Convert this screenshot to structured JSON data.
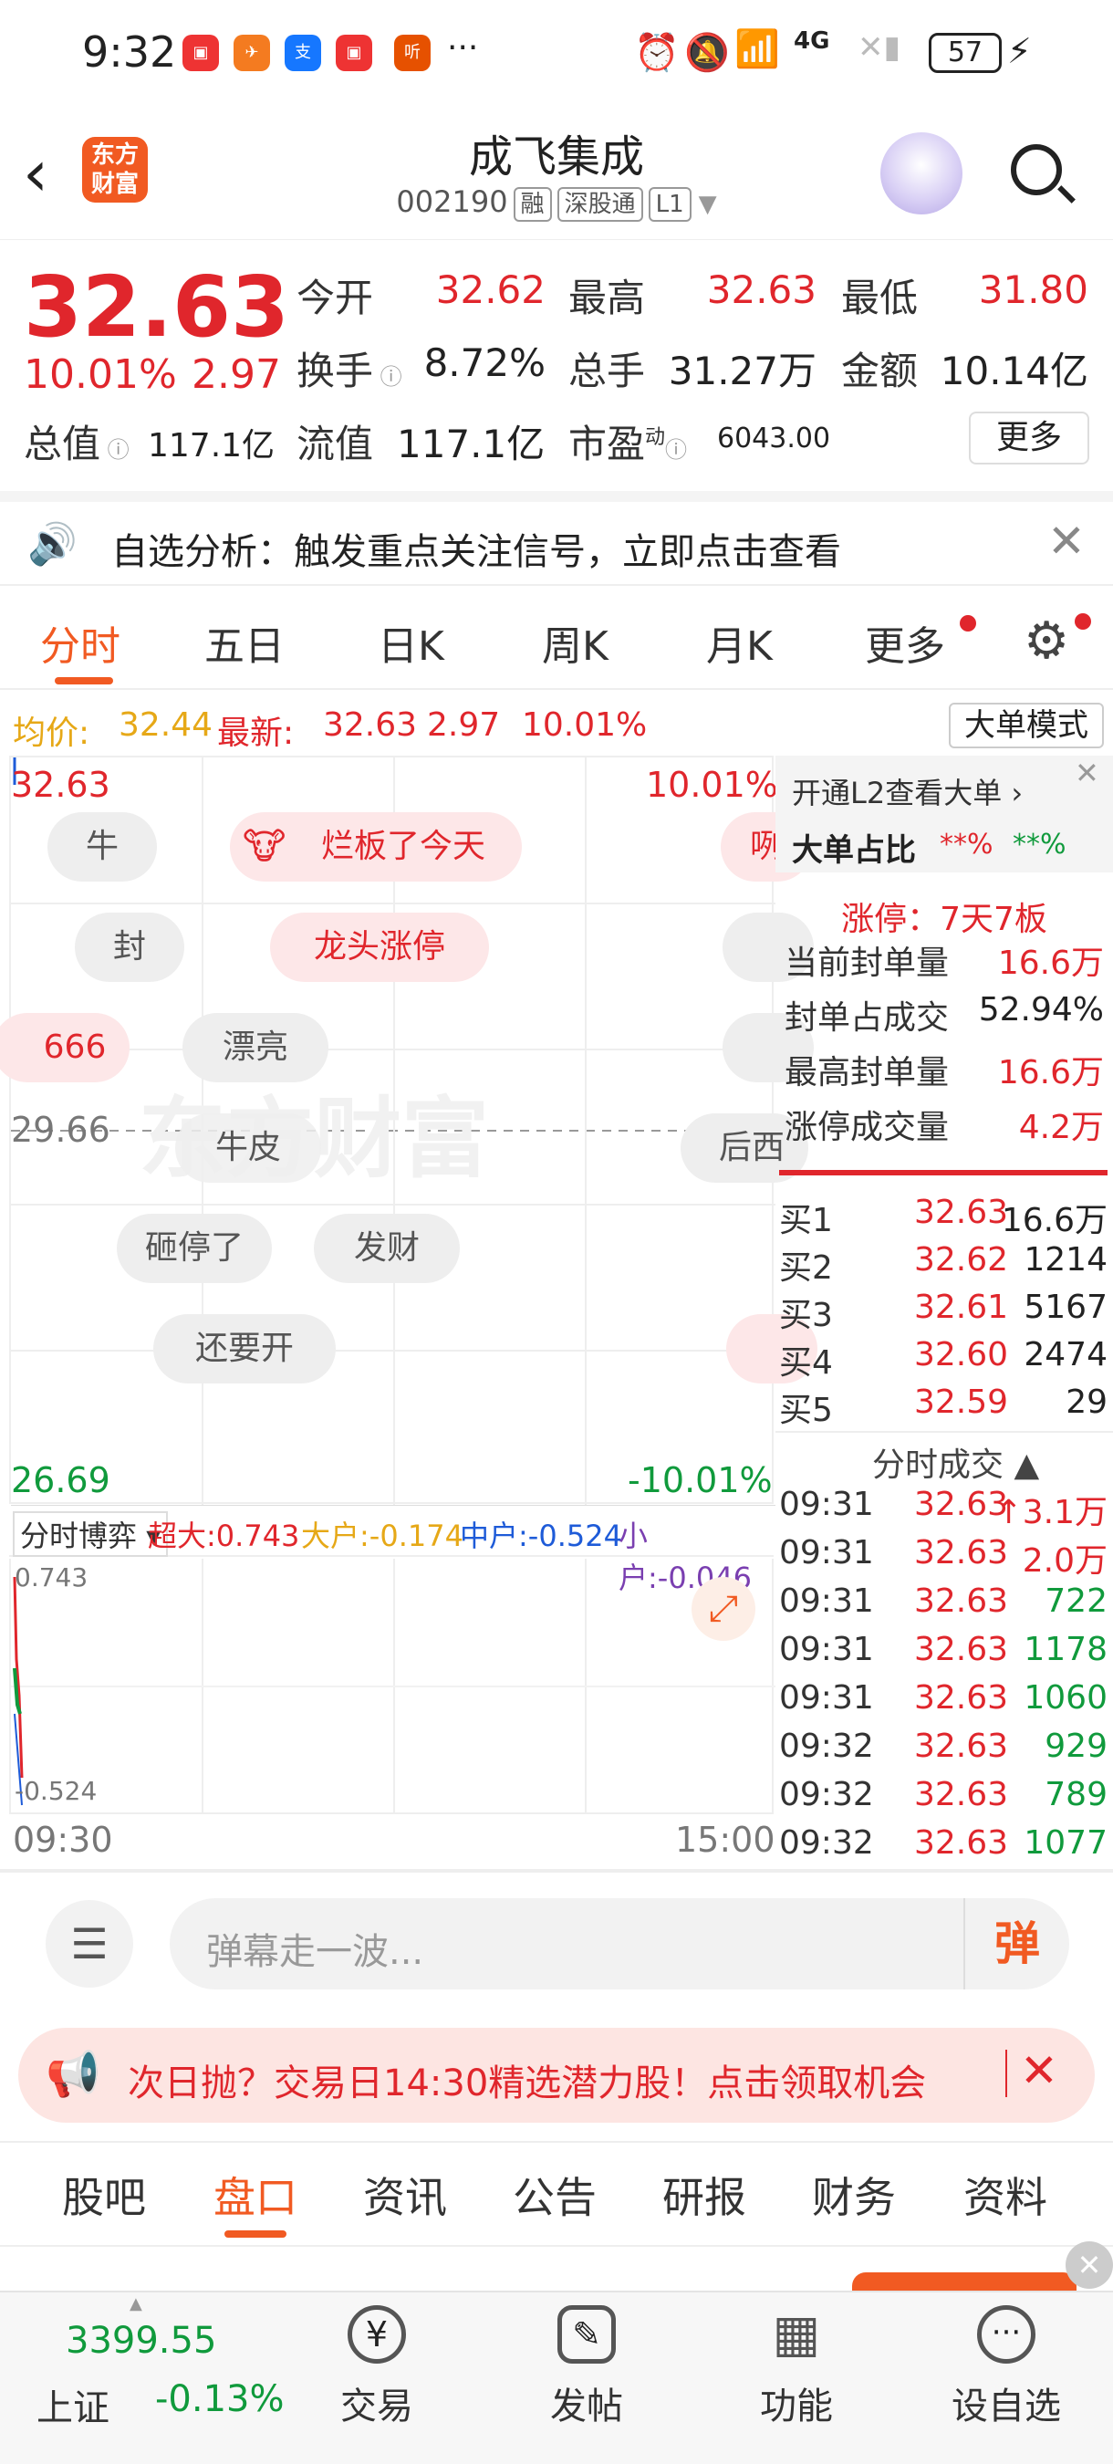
{
  "status_bar": {
    "time": "9:32",
    "dots": "···",
    "network": "4G",
    "battery": "57"
  },
  "header": {
    "logo_line1": "东方",
    "logo_line2": "财富",
    "title": "成飞集成",
    "code": "002190",
    "tags": [
      "融",
      "深股通",
      "L1"
    ]
  },
  "quote": {
    "price": "32.63",
    "change_pct": "10.01%",
    "change": "2.97",
    "open_label": "今开",
    "open": "32.62",
    "high_label": "最高",
    "high": "32.63",
    "low_label": "最低",
    "low": "31.80",
    "turnover_label": "换手",
    "turnover": "8.72%",
    "volume_label": "总手",
    "volume": "31.27万",
    "amount_label": "金额",
    "amount": "10.14亿",
    "mcap_label": "总值",
    "mcap": "117.1亿",
    "float_label": "流值",
    "float": "117.1亿",
    "pe_label": "市盈",
    "pe_sup": "动",
    "pe": "6043.00",
    "more_button": "更多"
  },
  "notice": {
    "text": "自选分析：触发重点关注信号，立即点击查看"
  },
  "chart_tabs": [
    "分时",
    "五日",
    "日K",
    "周K",
    "月K",
    "更多"
  ],
  "infoline": {
    "avg_label": "均价:",
    "avg": "32.44",
    "latest_label": "最新:",
    "latest": "32.63",
    "chg": "2.97",
    "pct": "10.01%",
    "big_order_button": "大单模式"
  },
  "chart": {
    "top_price": "32.63",
    "top_pct": "10.01%",
    "mid_price": "29.66",
    "bottom_price": "26.69",
    "bottom_pct": "-10.01%",
    "danmaku": [
      "牛",
      "烂板了今天",
      "封",
      "龙头涨停",
      "666",
      "漂亮",
      "牛皮",
      "砸停了",
      "发财",
      "还要开",
      "后西",
      "咧"
    ],
    "watermark": "东方财富",
    "flow_label": "分时博弈",
    "flow": [
      {
        "label": "超大:",
        "value": "0.743"
      },
      {
        "label": "大户:",
        "value": "-0.174"
      },
      {
        "label": "中户:",
        "value": "-0.524"
      },
      {
        "label": "小户:",
        "value": "-0.046"
      }
    ],
    "flow_max": "0.743",
    "flow_min": "-0.524",
    "time_start": "09:30",
    "time_end": "15:00"
  },
  "side": {
    "l2_link": "开通L2查看大单",
    "big_ratio_label": "大单占比",
    "big_ratio_1": "**%",
    "big_ratio_2": "**%",
    "limit_up": "涨停：7天7板",
    "stats": [
      {
        "label": "当前封单量",
        "value": "16.6万",
        "red": true
      },
      {
        "label": "封单占成交",
        "value": "52.94%",
        "red": false
      },
      {
        "label": "最高封单量",
        "value": "16.6万",
        "red": true
      },
      {
        "label": "涨停成交量",
        "value": "4.2万",
        "red": true
      }
    ],
    "bids": [
      {
        "label": "买1",
        "price": "32.63",
        "vol": "16.6万"
      },
      {
        "label": "买2",
        "price": "32.62",
        "vol": "1214"
      },
      {
        "label": "买3",
        "price": "32.61",
        "vol": "5167"
      },
      {
        "label": "买4",
        "price": "32.60",
        "vol": "2474"
      },
      {
        "label": "买5",
        "price": "32.59",
        "vol": "29"
      }
    ],
    "trades_title": "分时成交",
    "trades": [
      {
        "time": "09:31",
        "price": "32.63",
        "vol": "↑3.1万"
      },
      {
        "time": "09:31",
        "price": "32.63",
        "vol": "2.0万"
      },
      {
        "time": "09:31",
        "price": "32.63",
        "vol": "722"
      },
      {
        "time": "09:31",
        "price": "32.63",
        "vol": "1178"
      },
      {
        "time": "09:31",
        "price": "32.63",
        "vol": "1060"
      },
      {
        "time": "09:32",
        "price": "32.63",
        "vol": "929"
      },
      {
        "time": "09:32",
        "price": "32.63",
        "vol": "789"
      },
      {
        "time": "09:32",
        "price": "32.63",
        "vol": "1077"
      }
    ]
  },
  "comment": {
    "placeholder": "弹幕走一波...",
    "danmaku_button": "弹"
  },
  "promo": {
    "text": "次日抛？交易日14:30精选潜力股！点击领取机会"
  },
  "bottom_tabs": [
    "股吧",
    "盘口",
    "资讯",
    "公告",
    "研报",
    "财务",
    "资料"
  ],
  "footer": {
    "index_value": "3399.55",
    "index_name": "上证",
    "index_pct": "-0.13%",
    "items": [
      "交易",
      "发帖",
      "功能",
      "设自选"
    ]
  },
  "colors": {
    "up": "#e0262c",
    "down": "#109a3c",
    "accent": "#f15a22",
    "avg_line": "#e6a817"
  }
}
